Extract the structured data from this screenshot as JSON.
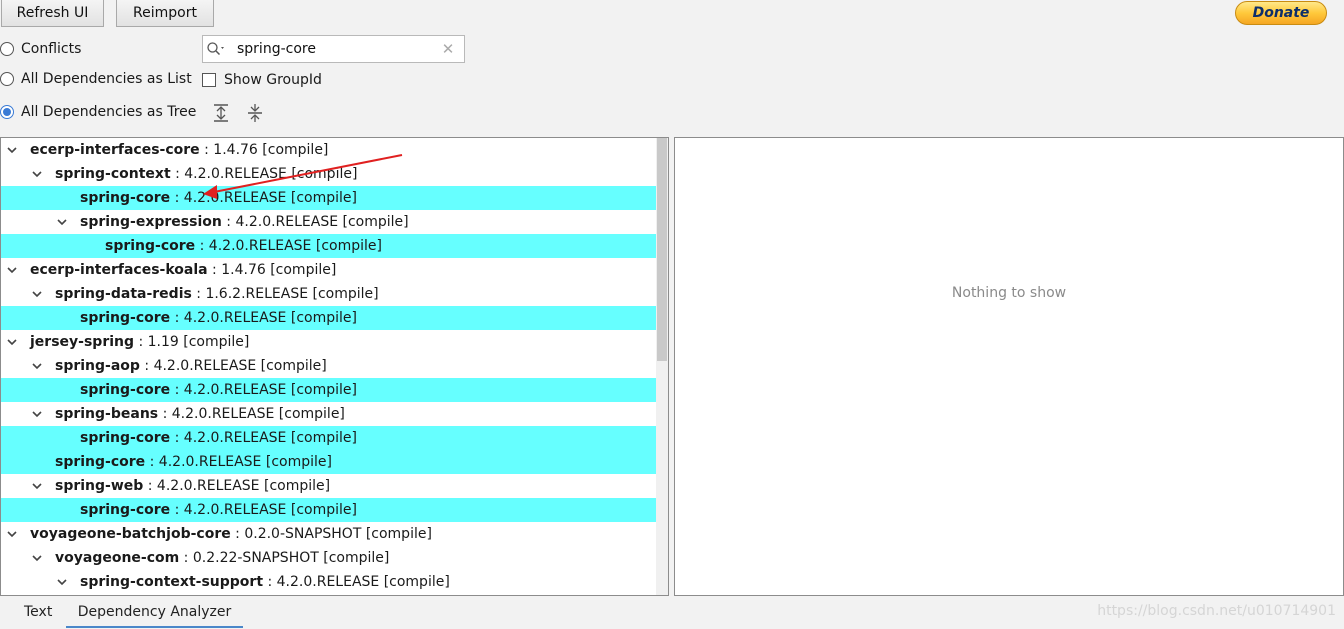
{
  "toolbar": {
    "refresh_label": "Refresh UI",
    "reimport_label": "Reimport",
    "donate_label": "Donate"
  },
  "options": {
    "conflicts": "Conflicts",
    "all_list": "All Dependencies as List",
    "all_tree": "All Dependencies as Tree",
    "show_groupid": "Show GroupId",
    "selected": "all_tree"
  },
  "search": {
    "value": "spring-core"
  },
  "tree": [
    {
      "level": 0,
      "expanded": true,
      "highlight": false,
      "artifact": "ecerp-interfaces-core",
      "detail": " : 1.4.76 [compile]"
    },
    {
      "level": 1,
      "expanded": true,
      "highlight": false,
      "artifact": "spring-context",
      "detail": " : 4.2.0.RELEASE [compile]"
    },
    {
      "level": 2,
      "expanded": null,
      "highlight": true,
      "artifact": "spring-core",
      "detail": " : 4.2.0.RELEASE [compile]"
    },
    {
      "level": 2,
      "expanded": true,
      "highlight": false,
      "artifact": "spring-expression",
      "detail": " : 4.2.0.RELEASE [compile]"
    },
    {
      "level": 3,
      "expanded": null,
      "highlight": true,
      "artifact": "spring-core",
      "detail": " : 4.2.0.RELEASE [compile]"
    },
    {
      "level": 0,
      "expanded": true,
      "highlight": false,
      "artifact": "ecerp-interfaces-koala",
      "detail": " : 1.4.76 [compile]"
    },
    {
      "level": 1,
      "expanded": true,
      "highlight": false,
      "artifact": "spring-data-redis",
      "detail": " : 1.6.2.RELEASE [compile]"
    },
    {
      "level": 2,
      "expanded": null,
      "highlight": true,
      "artifact": "spring-core",
      "detail": " : 4.2.0.RELEASE [compile]"
    },
    {
      "level": 0,
      "expanded": true,
      "highlight": false,
      "artifact": "jersey-spring",
      "detail": " : 1.19 [compile]"
    },
    {
      "level": 1,
      "expanded": true,
      "highlight": false,
      "artifact": "spring-aop",
      "detail": " : 4.2.0.RELEASE [compile]"
    },
    {
      "level": 2,
      "expanded": null,
      "highlight": true,
      "artifact": "spring-core",
      "detail": " : 4.2.0.RELEASE [compile]"
    },
    {
      "level": 1,
      "expanded": true,
      "highlight": false,
      "artifact": "spring-beans",
      "detail": " : 4.2.0.RELEASE [compile]"
    },
    {
      "level": 2,
      "expanded": null,
      "highlight": true,
      "artifact": "spring-core",
      "detail": " : 4.2.0.RELEASE [compile]"
    },
    {
      "level": 1,
      "expanded": null,
      "highlight": true,
      "artifact": "spring-core",
      "detail": " : 4.2.0.RELEASE [compile]"
    },
    {
      "level": 1,
      "expanded": true,
      "highlight": false,
      "artifact": "spring-web",
      "detail": " : 4.2.0.RELEASE [compile]"
    },
    {
      "level": 2,
      "expanded": null,
      "highlight": true,
      "artifact": "spring-core",
      "detail": " : 4.2.0.RELEASE [compile]"
    },
    {
      "level": 0,
      "expanded": true,
      "highlight": false,
      "artifact": "voyageone-batchjob-core",
      "detail": " : 0.2.0-SNAPSHOT [compile]"
    },
    {
      "level": 1,
      "expanded": true,
      "highlight": false,
      "artifact": "voyageone-com",
      "detail": " : 0.2.22-SNAPSHOT [compile]"
    },
    {
      "level": 2,
      "expanded": true,
      "highlight": false,
      "artifact": "spring-context-support",
      "detail": " : 4.2.0.RELEASE [compile]"
    }
  ],
  "detail_panel": {
    "empty_text": "Nothing to show"
  },
  "tabs": [
    {
      "label": "Text"
    },
    {
      "label": "Dependency Analyzer"
    }
  ],
  "watermark": "https://blog.csdn.net/u010714901",
  "colors": {
    "highlight": "#66ffff",
    "annotation_arrow": "#e02020",
    "accent": "#3a7bd5"
  }
}
